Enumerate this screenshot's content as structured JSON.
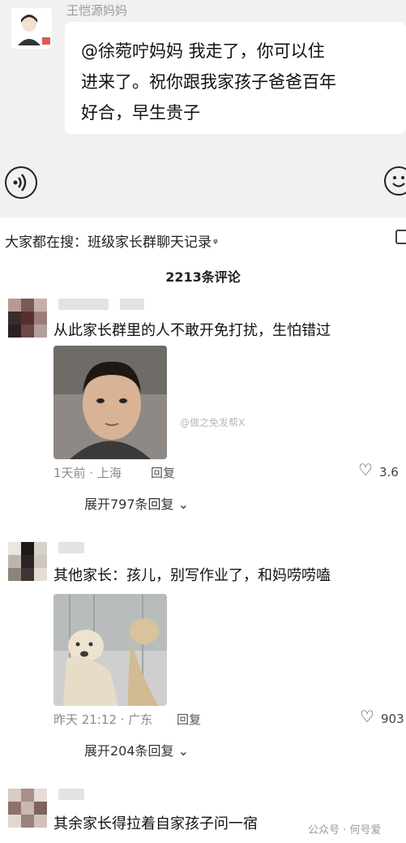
{
  "chat": {
    "sender_name": "王恺源妈妈",
    "message_line1": "@徐菀咛妈妈  我走了，你可以住",
    "message_line2": "进来了。祝你跟我家孩子爸爸百年",
    "message_line3": "好合，早生贵子"
  },
  "search_tip": {
    "prefix": "大家都在搜：",
    "query": "班级家长群聊天记录",
    "icon": "search-icon",
    "icon_glyph": "ᵠ"
  },
  "comment_count": "2213条评论",
  "comments": [
    {
      "text": "从此家长群里的人不敢开免打扰，生怕错过",
      "image_watermark": "@做之免发帮X",
      "time_location": "1天前 · 上海",
      "reply": "回复",
      "likes": "3.6",
      "expand": "展开797条回复"
    },
    {
      "text": "其他家长：孩儿，别写作业了，和妈唠唠嗑",
      "time_location": "昨天 21:12 · 广东",
      "reply": "回复",
      "likes": "903",
      "expand": "展开204条回复"
    },
    {
      "text": "其余家长得拉着自家孩子问一宿"
    }
  ],
  "footer_watermark": "公众号 · 何号爱",
  "colors": {
    "chat_background": "#f1f1f1",
    "meta_gray": "#8a8a8a"
  }
}
